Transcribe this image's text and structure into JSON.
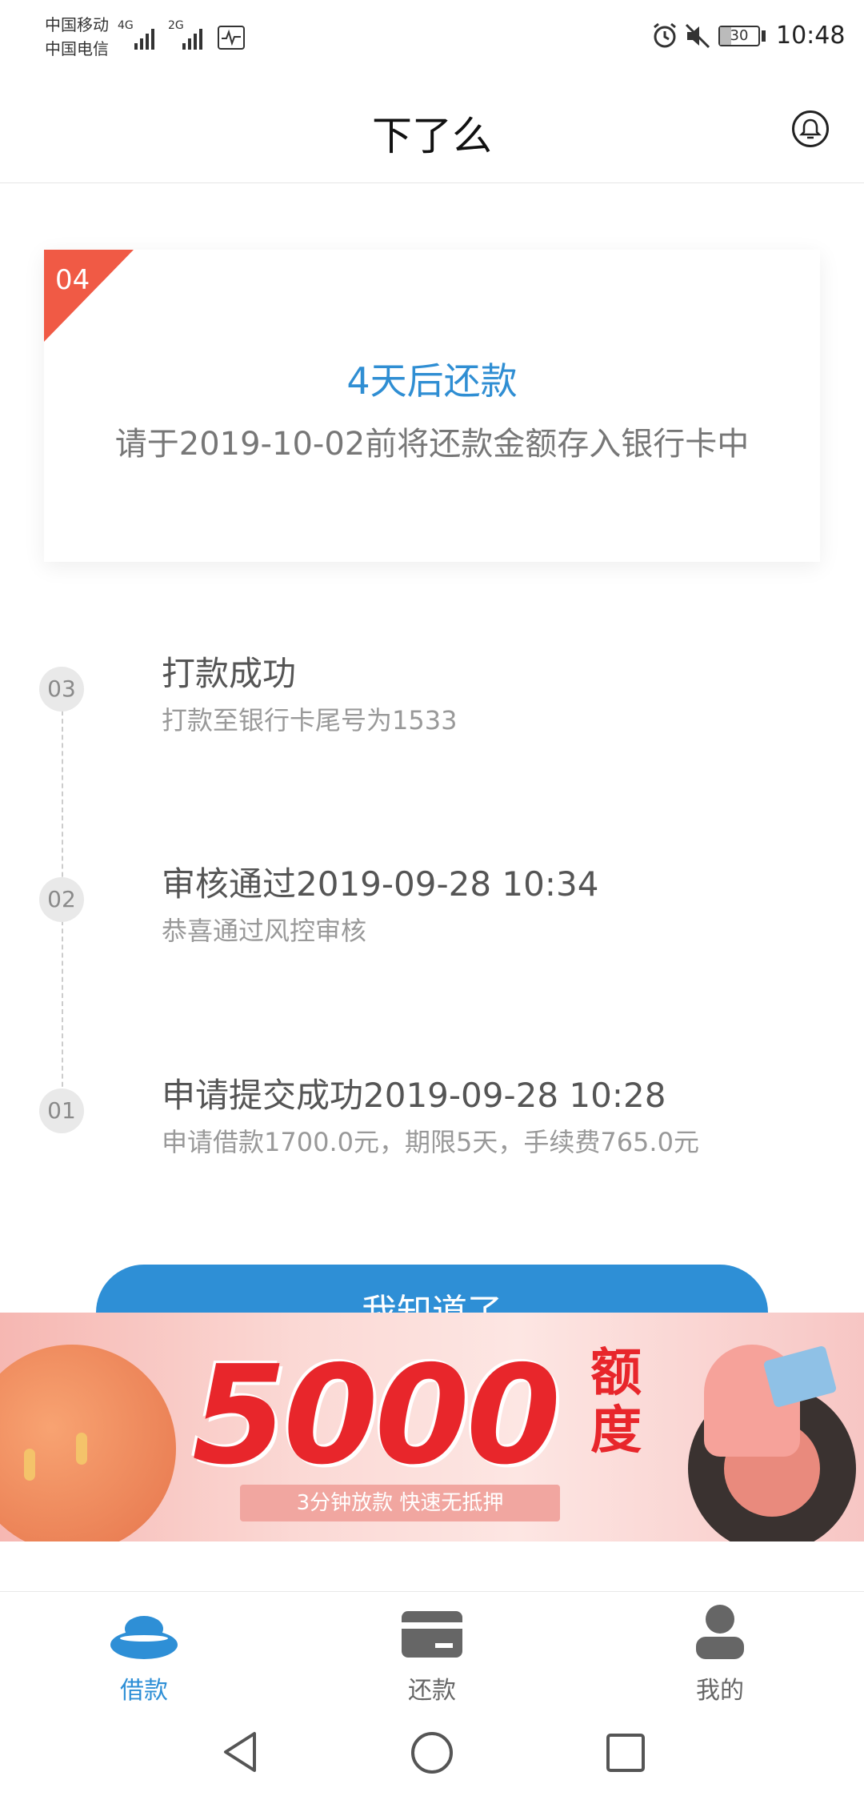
{
  "status_bar": {
    "carrier1": "中国移动",
    "carrier2": "中国电信",
    "net1": "4G",
    "net2": "2G",
    "battery": "30",
    "time": "10:48"
  },
  "header": {
    "title": "下了么"
  },
  "card": {
    "badge": "04",
    "title": "4天后还款",
    "description": "请于2019-10-02前将还款金额存入银行卡中"
  },
  "timeline": [
    {
      "step": "03",
      "title": "打款成功",
      "subtitle": "打款至银行卡尾号为1533"
    },
    {
      "step": "02",
      "title": "审核通过2019-09-28 10:34",
      "subtitle": "恭喜通过风控审核"
    },
    {
      "step": "01",
      "title": "申请提交成功2019-09-28 10:28",
      "subtitle": "申请借款1700.0元，期限5天，手续费765.0元"
    }
  ],
  "confirm_button": "我知道了",
  "banner": {
    "amount": "5000",
    "unit": "额度",
    "subtitle": "3分钟放款 快速无抵押"
  },
  "tabbar": {
    "active_color": "#2e8fd6",
    "inactive_color": "#666666",
    "items": [
      {
        "label": "借款",
        "icon": "ingot-icon",
        "active": true
      },
      {
        "label": "还款",
        "icon": "card-icon",
        "active": false
      },
      {
        "label": "我的",
        "icon": "user-icon",
        "active": false
      }
    ]
  }
}
